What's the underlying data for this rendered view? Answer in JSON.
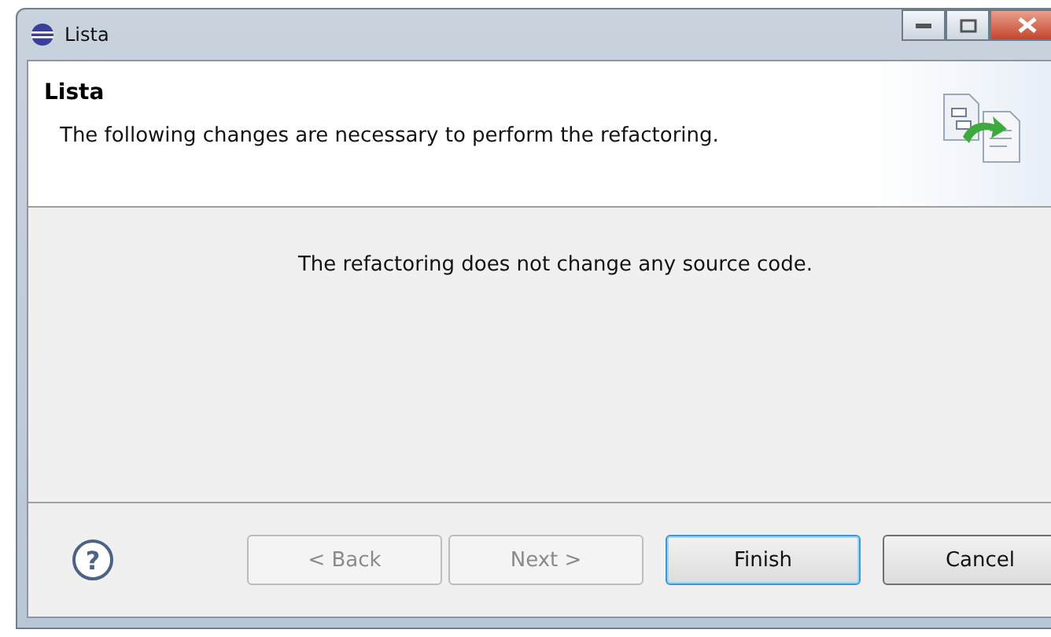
{
  "window": {
    "title": "Lista"
  },
  "header": {
    "title": "Lista",
    "description": "The following changes are necessary to perform the refactoring."
  },
  "help": "?",
  "message": "The refactoring does not change any source code.",
  "buttons": [
    {
      "label": "< Back",
      "disabled": true,
      "default": false
    },
    {
      "label": "Next >",
      "disabled": true,
      "default": false
    },
    {
      "label": "Finish",
      "disabled": false,
      "default": true
    },
    {
      "label": "Cancel",
      "disabled": false,
      "default": false
    }
  ]
}
